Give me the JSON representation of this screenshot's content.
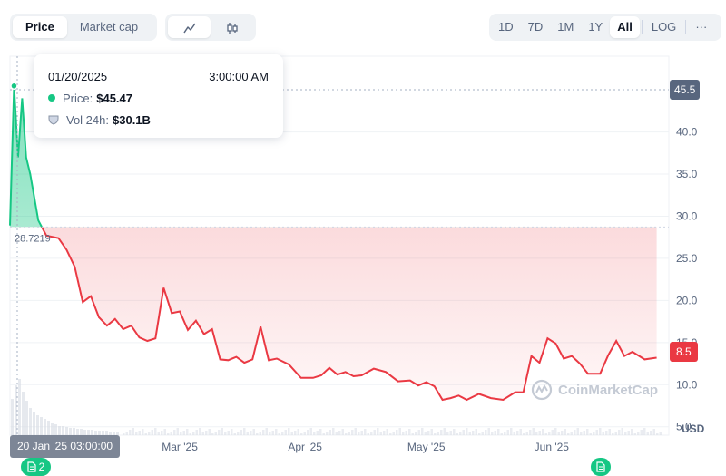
{
  "tabs": [
    "Price",
    "Market cap"
  ],
  "chart_types": [
    {
      "icon": "line-chart-icon"
    },
    {
      "icon": "candlestick-icon"
    }
  ],
  "ranges": [
    "1D",
    "7D",
    "1M",
    "1Y",
    "All",
    "LOG"
  ],
  "active_range": "All",
  "more_label": "···",
  "tooltip": {
    "date": "01/20/2025",
    "time": "3:00:00 AM",
    "price_label": "Price:",
    "price_value": "$45.47",
    "vol_label": "Vol 24h:",
    "vol_value": "$30.1B"
  },
  "current_price_tag": "45.5",
  "last_price_tag": "8.5",
  "open_price_label": "28.7219",
  "hover_date_label": "20 Jan '25 03:00:00",
  "notes": [
    {
      "count": "2"
    },
    {
      "count": ""
    }
  ],
  "watermark": "CoinMarketCap",
  "currency_label": "USD",
  "colors": {
    "up": "#16c784",
    "down": "#ea3943",
    "grid": "#eff2f5"
  },
  "chart_data": {
    "type": "area",
    "ylim": [
      4,
      49
    ],
    "yticks": [
      5,
      10,
      15,
      20,
      25,
      30,
      35,
      40
    ],
    "ytick_labels": [
      "5.0",
      "10.0",
      "15.0",
      "20.0",
      "25.0",
      "30.0",
      "35.0",
      "40.0"
    ],
    "xlim": [
      "2025-01-18",
      "2025-06-30"
    ],
    "xticks": [
      {
        "date": "2025-03-01",
        "label": "Mar '25"
      },
      {
        "date": "2025-04-01",
        "label": "Apr '25"
      },
      {
        "date": "2025-05-01",
        "label": "May '25"
      },
      {
        "date": "2025-06-01",
        "label": "Jun '25"
      }
    ],
    "baseline": 28.7219,
    "series": [
      {
        "points": [
          [
            "2025-01-18",
            28.9
          ],
          [
            "2025-01-19",
            45.47
          ],
          [
            "2025-01-20",
            37.0
          ],
          [
            "2025-01-21",
            44.0
          ],
          [
            "2025-01-22",
            37.0
          ],
          [
            "2025-01-23",
            35.0
          ],
          [
            "2025-01-25",
            29.5
          ],
          [
            "2025-01-27",
            27.7
          ],
          [
            "2025-01-30",
            27.4
          ],
          [
            "2025-02-01",
            26.0
          ],
          [
            "2025-02-03",
            24.0
          ],
          [
            "2025-02-05",
            19.8
          ],
          [
            "2025-02-07",
            20.5
          ],
          [
            "2025-02-09",
            18.0
          ],
          [
            "2025-02-11",
            17.0
          ],
          [
            "2025-02-13",
            17.8
          ],
          [
            "2025-02-15",
            16.6
          ],
          [
            "2025-02-17",
            17.0
          ],
          [
            "2025-02-19",
            15.6
          ],
          [
            "2025-02-21",
            15.2
          ],
          [
            "2025-02-23",
            15.5
          ],
          [
            "2025-02-25",
            21.5
          ],
          [
            "2025-02-27",
            18.5
          ],
          [
            "2025-03-01",
            18.7
          ],
          [
            "2025-03-03",
            16.5
          ],
          [
            "2025-03-05",
            17.6
          ],
          [
            "2025-03-07",
            16.0
          ],
          [
            "2025-03-09",
            16.6
          ],
          [
            "2025-03-11",
            13.0
          ],
          [
            "2025-03-13",
            12.9
          ],
          [
            "2025-03-15",
            13.3
          ],
          [
            "2025-03-17",
            12.6
          ],
          [
            "2025-03-19",
            13.0
          ],
          [
            "2025-03-21",
            16.9
          ],
          [
            "2025-03-23",
            12.9
          ],
          [
            "2025-03-25",
            13.1
          ],
          [
            "2025-03-28",
            12.4
          ],
          [
            "2025-03-31",
            10.8
          ],
          [
            "2025-04-03",
            10.8
          ],
          [
            "2025-04-05",
            11.1
          ],
          [
            "2025-04-07",
            12.0
          ],
          [
            "2025-04-09",
            11.2
          ],
          [
            "2025-04-11",
            11.5
          ],
          [
            "2025-04-13",
            11.0
          ],
          [
            "2025-04-15",
            11.1
          ],
          [
            "2025-04-18",
            11.9
          ],
          [
            "2025-04-21",
            11.5
          ],
          [
            "2025-04-24",
            10.4
          ],
          [
            "2025-04-27",
            10.5
          ],
          [
            "2025-04-29",
            9.9
          ],
          [
            "2025-05-01",
            10.3
          ],
          [
            "2025-05-03",
            9.8
          ],
          [
            "2025-05-05",
            8.2
          ],
          [
            "2025-05-07",
            8.4
          ],
          [
            "2025-05-09",
            8.7
          ],
          [
            "2025-05-11",
            8.2
          ],
          [
            "2025-05-14",
            8.9
          ],
          [
            "2025-05-17",
            8.4
          ],
          [
            "2025-05-20",
            8.2
          ],
          [
            "2025-05-23",
            9.1
          ],
          [
            "2025-05-25",
            9.1
          ],
          [
            "2025-05-27",
            13.4
          ],
          [
            "2025-05-29",
            12.6
          ],
          [
            "2025-05-31",
            15.5
          ],
          [
            "2025-06-02",
            14.9
          ],
          [
            "2025-06-04",
            13.1
          ],
          [
            "2025-06-06",
            13.4
          ],
          [
            "2025-06-08",
            12.5
          ],
          [
            "2025-06-10",
            11.3
          ],
          [
            "2025-06-13",
            11.3
          ],
          [
            "2025-06-15",
            13.5
          ],
          [
            "2025-06-17",
            15.2
          ],
          [
            "2025-06-19",
            13.4
          ],
          [
            "2025-06-21",
            13.9
          ],
          [
            "2025-06-24",
            13.0
          ],
          [
            "2025-06-27",
            13.2
          ]
        ]
      }
    ]
  }
}
